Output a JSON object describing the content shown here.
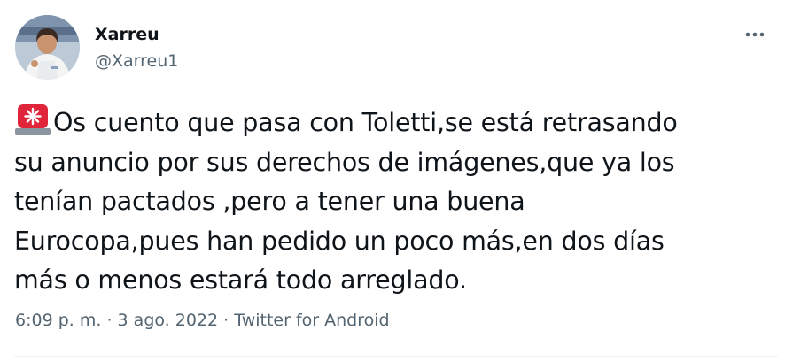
{
  "author": {
    "name": "Xarreu",
    "handle": "@Xarreu1"
  },
  "tweet": {
    "lines": [
      "Os cuento que pasa con Toletti,se está retrasando",
      "su anuncio por sus derechos de imágenes,que ya los",
      "tenían pactados ,pero a tener una buena",
      "Eurocopa,pues han pedido un poco más,en dos días",
      "más o menos estará todo arreglado."
    ],
    "leading_icon": "rotating-light-icon"
  },
  "meta": {
    "time": "6:09 p. m.",
    "separator": "·",
    "date": "3 ago. 2022",
    "source": "Twitter for Android"
  },
  "more_icon": "more-horizontal-icon",
  "colors": {
    "text": "#0f1419",
    "secondary": "#536471",
    "siren_red": "#e0243a"
  }
}
